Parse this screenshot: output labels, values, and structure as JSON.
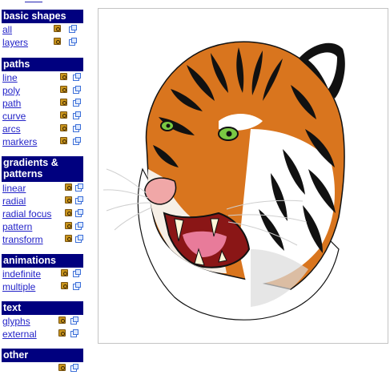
{
  "sidebar": {
    "sections": [
      {
        "title": "basic shapes",
        "items": [
          "all",
          "layers"
        ]
      },
      {
        "title": "paths",
        "items": [
          "line",
          "poly",
          "path",
          "curve",
          "arcs",
          "markers"
        ]
      },
      {
        "title": "gradients & patterns",
        "items": [
          "linear",
          "radial",
          "radial focus",
          "pattern",
          "transform"
        ]
      },
      {
        "title": "animations",
        "items": [
          "indefinite",
          "multiple"
        ]
      },
      {
        "title": "text",
        "items": [
          "glyphs",
          "external"
        ]
      },
      {
        "title": "other",
        "items": []
      }
    ]
  },
  "icons": {
    "view": "view-source-icon",
    "external": "open-external-icon"
  },
  "colors": {
    "header_bg": "#00007f",
    "link": "#2323c8",
    "tiger_orange": "#d9751e"
  }
}
